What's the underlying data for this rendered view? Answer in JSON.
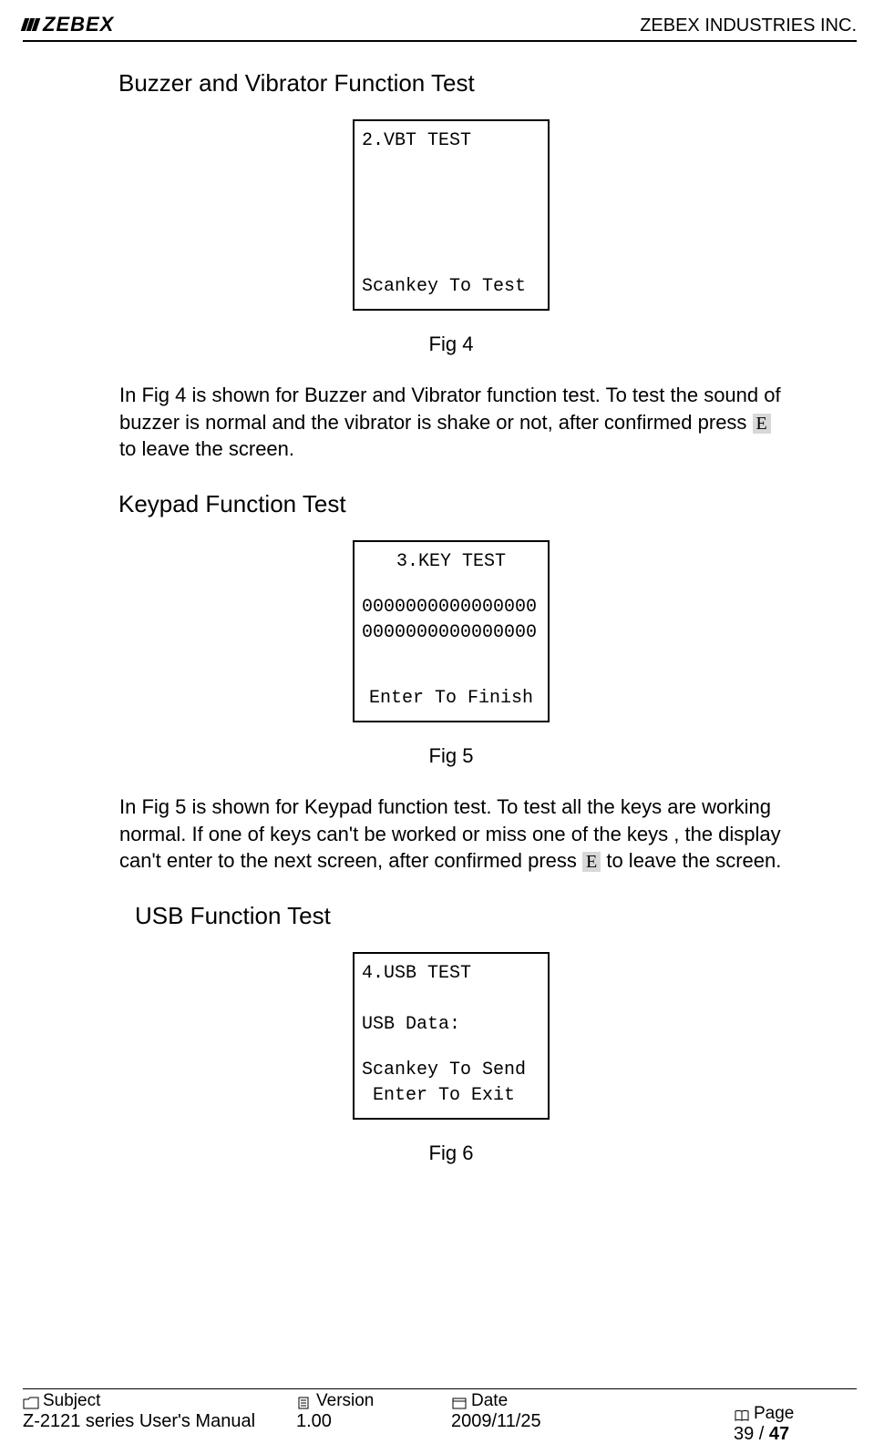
{
  "header": {
    "logo_text": "ZEBEX",
    "company": "ZEBEX INDUSTRIES INC."
  },
  "sections": {
    "s1": {
      "title": "Buzzer and Vibrator Function Test",
      "lcd": {
        "line1": "2.VBT TEST",
        "bottom": "Scankey To Test"
      },
      "fig_caption": "Fig 4",
      "para_pre": "In Fig 4 is shown for Buzzer and Vibrator function test. To test the sound of buzzer is normal and the vibrator is shake or not, after confirmed press ",
      "keycap": "E",
      "para_post": " to leave the screen."
    },
    "s2": {
      "title": "Keypad Function Test",
      "lcd": {
        "line1": "3.KEY TEST",
        "line2": "0000000000000000",
        "line3": "0000000000000000",
        "bottom": "Enter To Finish"
      },
      "fig_caption": "Fig 5",
      "para_pre": "In Fig 5 is shown for Keypad function test. To test all the keys are working normal. If one of keys can't be worked or miss one of the keys , the display can't enter to the next screen, after confirmed press ",
      "keycap": "E",
      "para_post": " to leave the screen."
    },
    "s3": {
      "title": "USB Function Test",
      "lcd": {
        "line1": "4.USB TEST",
        "line2": "USB Data:",
        "line3": "Scankey To Send",
        "line4": " Enter To Exit"
      },
      "fig_caption": "Fig 6"
    }
  },
  "footer": {
    "subject_label": "Subject",
    "subject_value": "Z-2121 series User's Manual",
    "version_label": "Version",
    "version_value": "1.00",
    "date_label": "Date",
    "date_value": "2009/11/25",
    "page_label": "Page",
    "page_current": "39",
    "page_sep": " / ",
    "page_total": "47"
  }
}
